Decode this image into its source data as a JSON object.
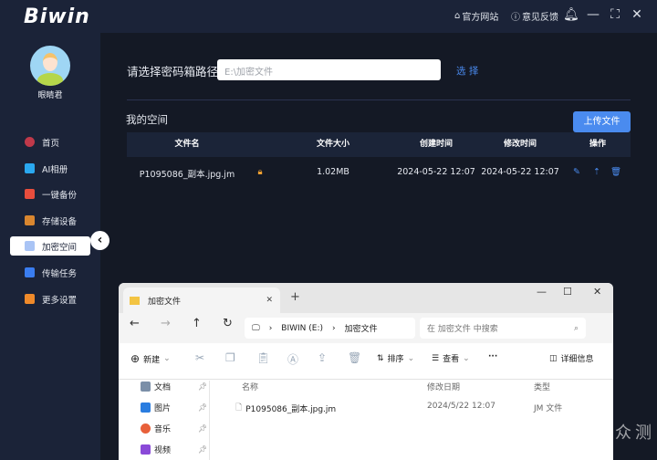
{
  "app": {
    "logo": "Biwin",
    "links": [
      {
        "label": "官方网站",
        "icon": "home-icon"
      },
      {
        "label": "意见反馈",
        "icon": "question-icon"
      }
    ],
    "window_controls": [
      "bell-icon",
      "minimize-icon",
      "maximize-icon",
      "close-icon"
    ]
  },
  "user": {
    "name": "眼睛君"
  },
  "sidebar": {
    "items": [
      {
        "label": "首页",
        "color": "#c0394a"
      },
      {
        "label": "AI相册",
        "color": "#2aa8f0"
      },
      {
        "label": "一键备份",
        "color": "#e84d3d"
      },
      {
        "label": "存储设备",
        "color": "#d9862f"
      },
      {
        "label": "加密空间",
        "color": "#4a8bef",
        "selected": true
      },
      {
        "label": "传输任务",
        "color": "#3a7df0"
      },
      {
        "label": "更多设置",
        "color": "#f08a2a"
      }
    ]
  },
  "main": {
    "path_label": "请选择密码箱路径",
    "path_placeholder": "E:\\加密文件",
    "select_label": "选 择",
    "section_title": "我的空间",
    "upload_label": "上传文件",
    "accent": "#4a8bef",
    "columns": [
      "文件名",
      "文件大小",
      "创建时间",
      "修改时间",
      "操作"
    ],
    "rows": [
      {
        "name": "P1095086_副本.jpg.jm",
        "size": "1.02MB",
        "created": "2024-05-22 12:07",
        "modified": "2024-05-22 12:07",
        "locked": true
      }
    ]
  },
  "explorer": {
    "tab": "加密文件",
    "breadcrumb": [
      "BIWIN (E:)",
      "加密文件"
    ],
    "search_placeholder": "在 加密文件 中搜索",
    "toolbar": {
      "new": "新建",
      "sort": "排序",
      "view": "查看",
      "more": "···",
      "details": "详细信息"
    },
    "nav": [
      {
        "label": "文档",
        "color": "#7b8fa8"
      },
      {
        "label": "图片",
        "color": "#2a7de0"
      },
      {
        "label": "音乐",
        "color": "#e8603a"
      },
      {
        "label": "视频",
        "color": "#8a4ad8"
      }
    ],
    "columns": [
      "名称",
      "修改日期",
      "类型"
    ],
    "files": [
      {
        "name": "P1095086_副本.jpg.jm",
        "date": "2024/5/22 12:07",
        "type": "JM 文件"
      }
    ]
  },
  "watermark": "新浪众测"
}
